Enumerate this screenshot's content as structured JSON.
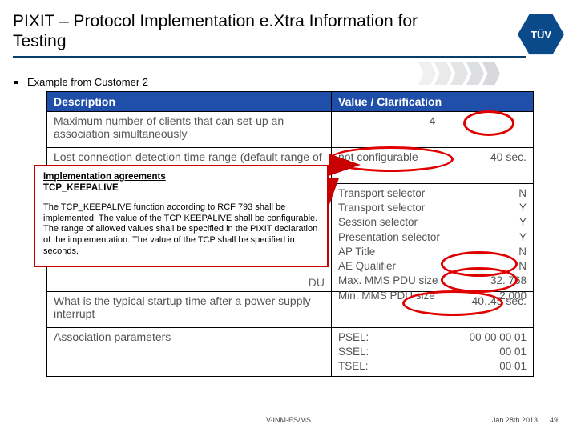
{
  "title": "PIXIT – Protocol Implementation e.Xtra Information for Testing",
  "logo_text": "TÜV",
  "bullet": "Example from Customer 2",
  "header": {
    "desc": "Description",
    "val": "Value / Clarification"
  },
  "rows": {
    "r1": {
      "desc": "Maximum number of clients that can set-up an association simultaneously",
      "val": "4"
    },
    "r2": {
      "desc": "Lost connection detection time range (default range of TCP_KEEPALIVE is 10 seconds)",
      "val_label": "not configurable",
      "val_right": "40 sec."
    },
    "r3": {
      "left_hidden": "DU",
      "items": [
        {
          "k": "Transport selector",
          "v": "N"
        },
        {
          "k": "Transport selector",
          "v": "Y"
        },
        {
          "k": "Session selector",
          "v": "Y"
        },
        {
          "k": "Presentation selector",
          "v": "Y"
        },
        {
          "k": "AP Title",
          "v": "N"
        },
        {
          "k": "AE Qualifier",
          "v": "N"
        },
        {
          "k": "Max. MMS PDU size",
          "v": "32. 768"
        },
        {
          "k": "Min. MMS PDU size",
          "v": "2.000"
        }
      ]
    },
    "r4": {
      "desc": "What is the typical startup time after a power supply interrupt",
      "val": "40..45 sec."
    },
    "r5": {
      "desc": "Association parameters",
      "items": [
        {
          "k": "PSEL:",
          "v": "00 00 00 01"
        },
        {
          "k": "SSEL:",
          "v": "00 01"
        },
        {
          "k": "TSEL:",
          "v": "00 01"
        }
      ]
    }
  },
  "callout": {
    "title": "Implementation agreements",
    "subtitle": "TCP_KEEPALIVE",
    "body": "The TCP_KEEPALIVE function according to RCF 793 shall be implemented. The value of the TCP KEEPALIVE shall be configurable. The range of allowed values shall be specified in the PIXIT declaration of the implementation. The value of the TCP shall be specified in seconds."
  },
  "footer": {
    "center": "V-INM-ES/MS",
    "right": "Jan 28th 2013",
    "page": "49"
  },
  "chart_data": {
    "type": "table",
    "title": "PIXIT – Protocol Implementation e.Xtra Information for Testing — Example from Customer 2",
    "columns": [
      "Description",
      "Value / Clarification"
    ],
    "rows": [
      [
        "Maximum number of clients that can set-up an association simultaneously",
        "4"
      ],
      [
        "Lost connection detection time range (default range of TCP_KEEPALIVE is 10 seconds)",
        "not configurable — 40 sec."
      ],
      [
        "Transport selector",
        "N"
      ],
      [
        "Transport selector",
        "Y"
      ],
      [
        "Session selector",
        "Y"
      ],
      [
        "Presentation selector",
        "Y"
      ],
      [
        "AP Title",
        "N"
      ],
      [
        "AE Qualifier",
        "N"
      ],
      [
        "Max. MMS PDU size",
        "32. 768"
      ],
      [
        "Min. MMS PDU size",
        "2.000"
      ],
      [
        "What is the typical startup time after a power supply interrupt",
        "40..45 sec."
      ],
      [
        "Association parameters — PSEL:",
        "00 00 00 01"
      ],
      [
        "Association parameters — SSEL:",
        "00 01"
      ],
      [
        "Association parameters — TSEL:",
        "00 01"
      ]
    ],
    "annotations": [
      "Circled: value 4",
      "Circled: not configurable",
      "Circled: 40..45 sec.",
      "Circled: Max. MMS PDU size 32. 768",
      "Circled: Min. MMS PDU size 2.000",
      "Callout: Implementation agreements — TCP_KEEPALIVE"
    ]
  }
}
